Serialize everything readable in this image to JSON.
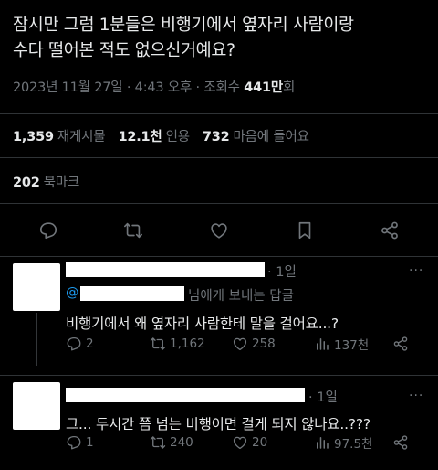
{
  "tweet": {
    "line1": "잠시만 그럼 1분들은 비행기에서 옆자리 사람이랑",
    "line2": "수다 떨어본 적도 없으신거예요?",
    "meta_time": "2023년 11월 27일 · 4:43 오후 · 조회수 ",
    "views": "441만",
    "views_suffix": "회"
  },
  "stats": {
    "retweets_count": "1,359",
    "retweets_label": "재게시물",
    "quotes_count": "12.1천",
    "quotes_label": "인용",
    "likes_count": "732",
    "likes_label": "마음에 들어요",
    "bookmarks_count": "202",
    "bookmarks_label": "북마크"
  },
  "icons": {
    "reply": "reply-icon",
    "retweet": "retweet-icon",
    "like": "heart-icon",
    "bookmark": "bookmark-icon",
    "share": "share-icon",
    "views": "analytics-icon",
    "more": "more-icon"
  },
  "replies": [
    {
      "time": "· 1일",
      "reply_to_prefix": "@",
      "reply_to_suffix": "님에게 보내는 답글",
      "text": "비행기에서 왜 옆자리 사람한테 말을 걸어요...?",
      "reply_count": "2",
      "retweet_count": "1,162",
      "like_count": "258",
      "view_count": "137천"
    },
    {
      "time": "· 1일",
      "text": "그... 두시간 쯤 넘는 비행이면 걸게 되지 않나요..???",
      "reply_count": "1",
      "retweet_count": "240",
      "like_count": "20",
      "view_count": "97.5천"
    }
  ],
  "colors": {
    "background": "#000000",
    "text": "#e7e9ea",
    "muted": "#71767b",
    "link": "#1d9bf0",
    "divider": "#2f3336"
  }
}
